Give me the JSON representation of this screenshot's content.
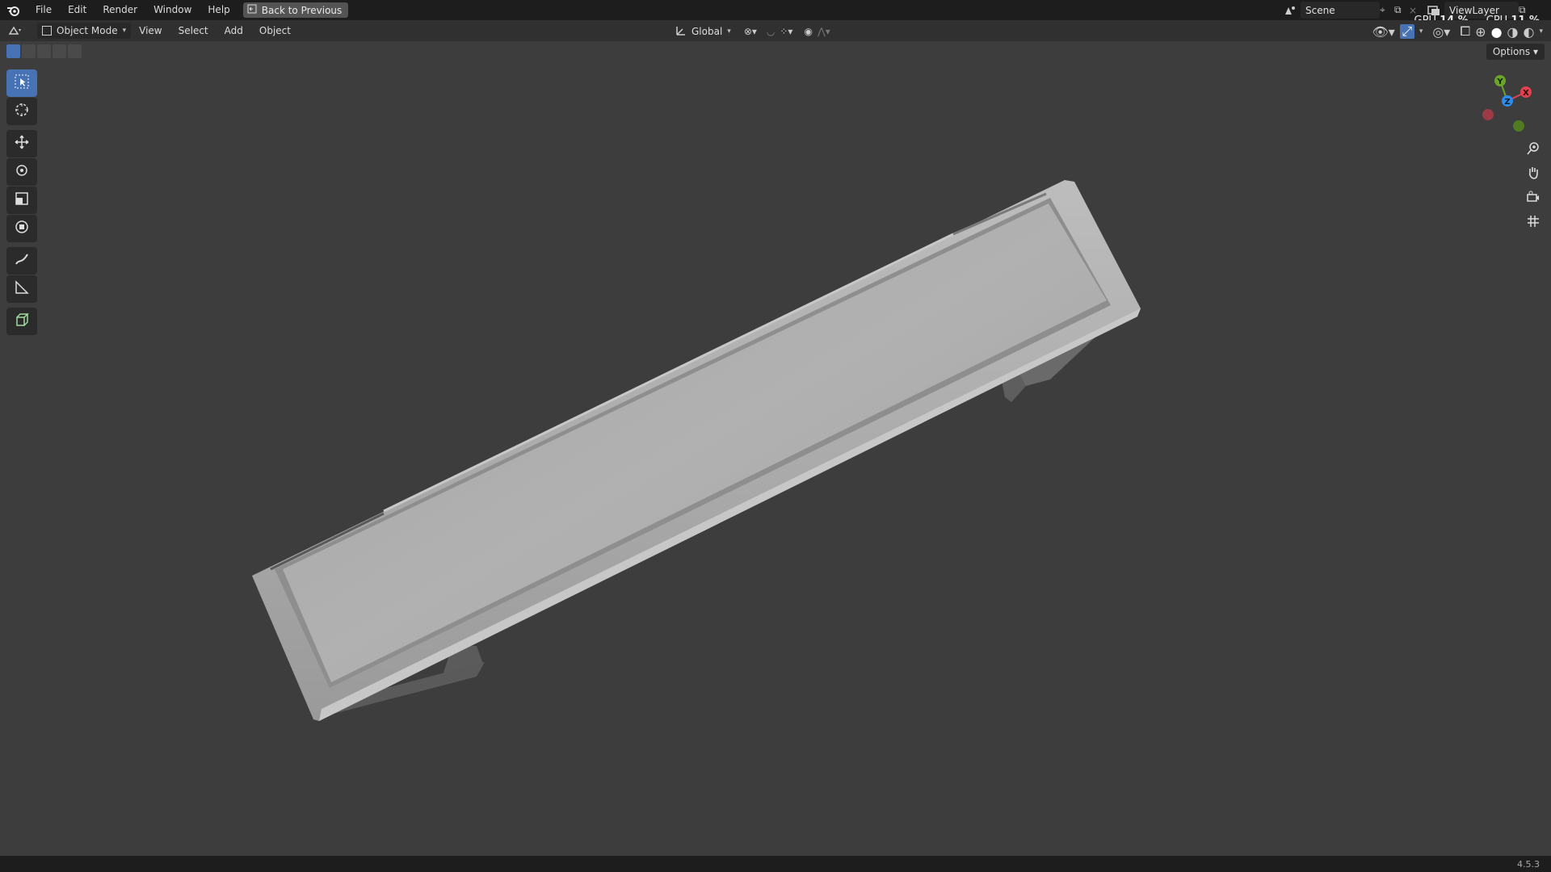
{
  "menu": {
    "items": [
      "File",
      "Edit",
      "Render",
      "Window",
      "Help"
    ],
    "back_button": "Back to Previous"
  },
  "scene": {
    "name": "Scene"
  },
  "view_layer": {
    "name": "ViewLayer"
  },
  "stats": {
    "gpu_label": "GPU",
    "gpu_value": "14 %",
    "cpu_label": "CPU",
    "cpu_value": "11 %"
  },
  "viewport_header": {
    "mode": "Object Mode",
    "menus": [
      "View",
      "Select",
      "Add",
      "Object"
    ],
    "transform_orientation": "Global"
  },
  "options_label": "Options",
  "gizmo_axes": {
    "y": "Y",
    "x": "X",
    "z": "Z"
  },
  "version": "4.5.3",
  "colors": {
    "accent": "#4772b3",
    "x_axis": "#e0434f",
    "y_axis": "#6aa52a",
    "z_axis": "#2d8ceb"
  }
}
